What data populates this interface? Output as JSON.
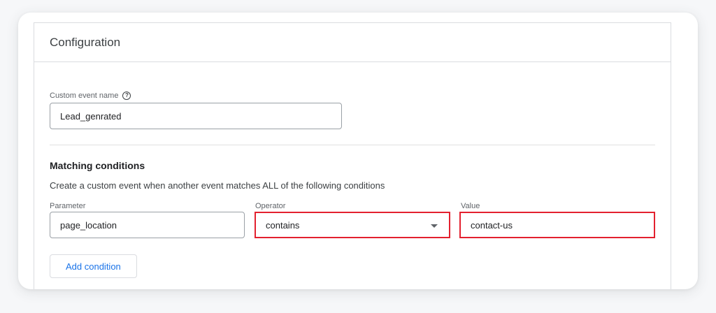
{
  "configuration": {
    "title": "Configuration",
    "custom_event": {
      "label": "Custom event name",
      "help_icon": "help-circle-icon",
      "value": "Lead_genrated"
    },
    "matching": {
      "title": "Matching conditions",
      "description": "Create a custom event when another event matches ALL of the following conditions",
      "parameter": {
        "label": "Parameter",
        "value": "page_location"
      },
      "operator": {
        "label": "Operator",
        "value": "contains",
        "icon": "dropdown-arrow-icon"
      },
      "value": {
        "label": "Value",
        "value": "contact-us"
      },
      "add_button": "Add condition"
    }
  },
  "colors": {
    "highlight": "#e3212f",
    "accent": "#1a73e8",
    "border": "#dadce0"
  }
}
